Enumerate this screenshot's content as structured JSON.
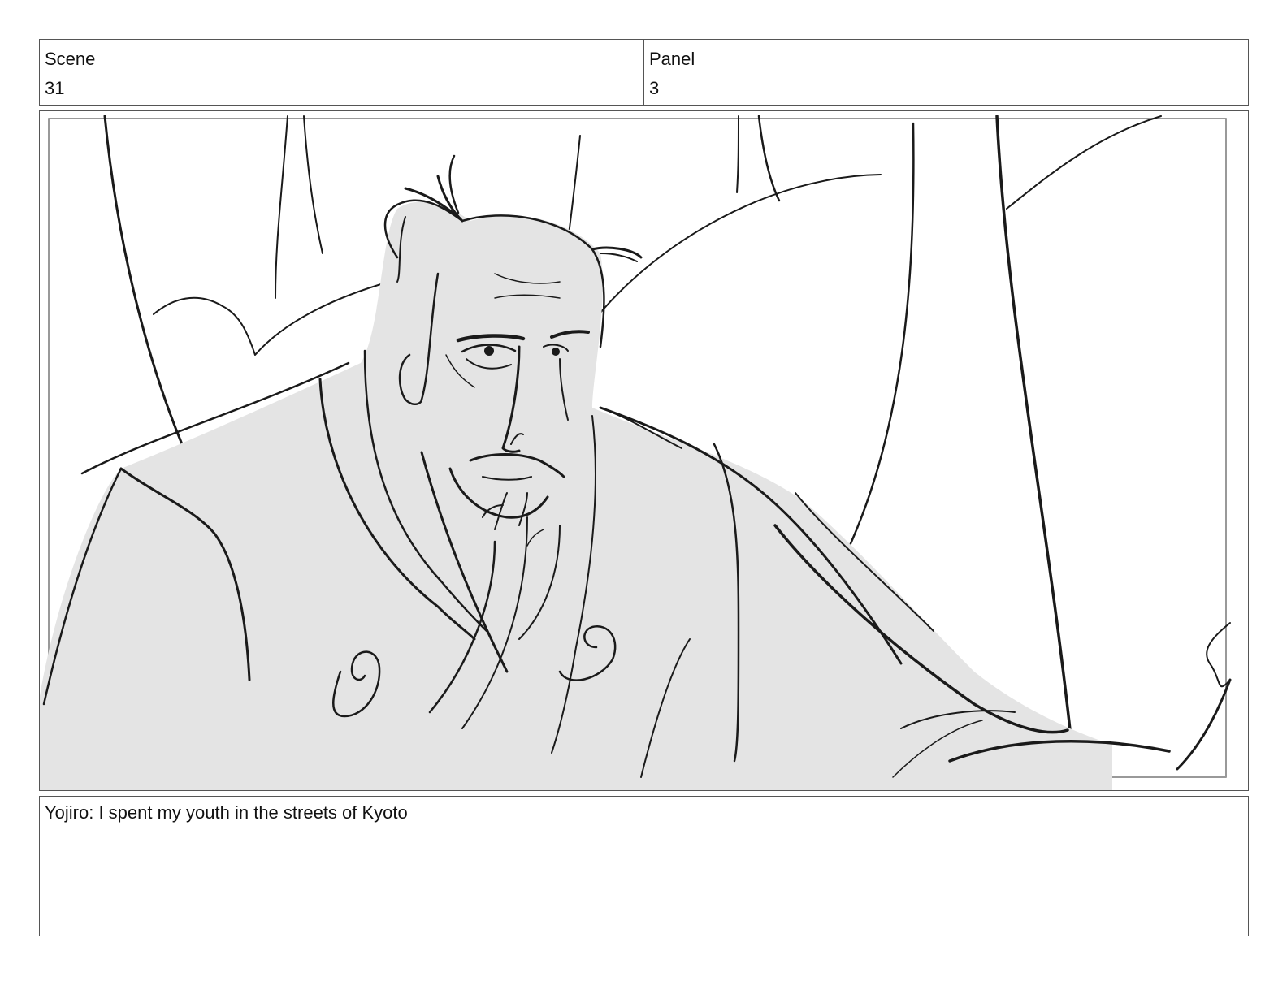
{
  "scene": {
    "label": "Scene",
    "value": "31"
  },
  "panel": {
    "label": "Panel",
    "value": "3"
  },
  "artwork": {
    "subject": "sketch of an older samurai in a kimono with a topknot, looking sideways, in front of large curved tree trunks",
    "fill_color": "#e4e4e4",
    "line_color": "#1a1a1a"
  },
  "caption": {
    "text": "Yojiro: I spent my youth in the streets of Kyoto"
  }
}
